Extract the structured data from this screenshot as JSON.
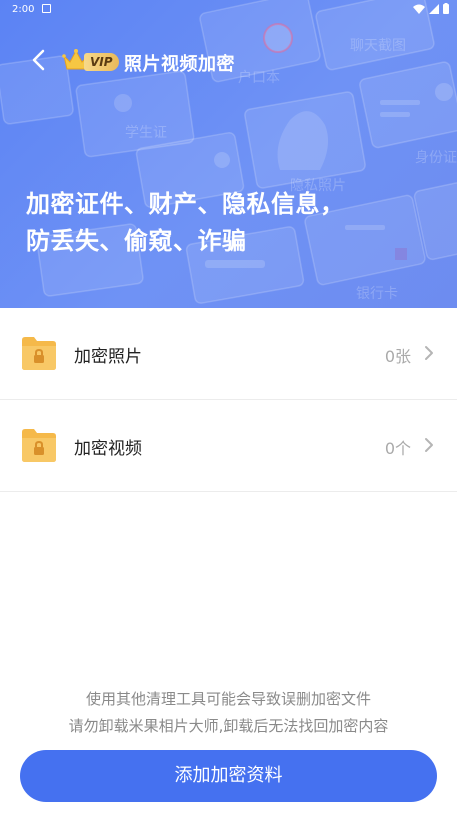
{
  "status_bar": {
    "time": "2:00"
  },
  "header": {
    "vip_label": "VIP",
    "title": "照片视频加密"
  },
  "hero": {
    "slogan_line1": "加密证件、财产、隐私信息，",
    "slogan_line2": "防丢失、偷窥、诈骗",
    "illustration_labels": {
      "hukouben": "户口本",
      "liaotian": "聊天截图",
      "xueshengzheng": "学生证",
      "shenfenzheng": "身份证",
      "yinhangka": "银行卡",
      "yinsi": "隐私照片"
    }
  },
  "list": {
    "items": [
      {
        "label": "加密照片",
        "count": "0张",
        "icon": "folder-lock-icon"
      },
      {
        "label": "加密视频",
        "count": "0个",
        "icon": "folder-lock-icon"
      }
    ]
  },
  "footer": {
    "notice_line1": "使用其他清理工具可能会导致误删加密文件",
    "notice_line2": "请勿卸载米果相片大师,卸载后无法找回加密内容",
    "add_button_label": "添加加密资料"
  },
  "colors": {
    "hero_gradient_start": "#5b83f4",
    "hero_gradient_end": "#6d8cf0",
    "primary_button": "#4571f0",
    "folder_icon": "#f5b94a",
    "vip_gold": "#e9b95a"
  }
}
